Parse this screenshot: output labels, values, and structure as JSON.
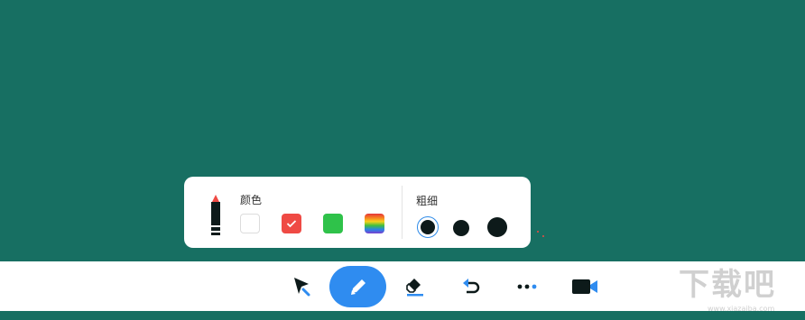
{
  "pen_panel": {
    "color_label": "颜色",
    "size_label": "粗细",
    "colors": [
      {
        "name": "white",
        "hex": "#ffffff",
        "selected": false
      },
      {
        "name": "red",
        "hex": "#ef4a44",
        "selected": true
      },
      {
        "name": "green",
        "hex": "#2fc24a",
        "selected": false
      },
      {
        "name": "rainbow",
        "hex": "gradient",
        "selected": false
      }
    ],
    "sizes": [
      {
        "name": "small",
        "selected": true
      },
      {
        "name": "medium",
        "selected": false
      },
      {
        "name": "large",
        "selected": false
      }
    ]
  },
  "toolbar": {
    "tools": [
      {
        "name": "select",
        "icon": "cursor-arrow-icon"
      },
      {
        "name": "pen",
        "icon": "pencil-icon",
        "active": true
      },
      {
        "name": "eraser",
        "icon": "eraser-icon"
      },
      {
        "name": "undo",
        "icon": "undo-icon"
      },
      {
        "name": "more",
        "icon": "more-dots-icon"
      },
      {
        "name": "camera",
        "icon": "video-camera-icon"
      }
    ]
  },
  "watermark": {
    "text": "下载吧",
    "url": "www.xiazaiba.com"
  },
  "colors": {
    "board": "#176f62",
    "accent": "#2f8cf0",
    "pen_tip": "#ef4a44"
  }
}
